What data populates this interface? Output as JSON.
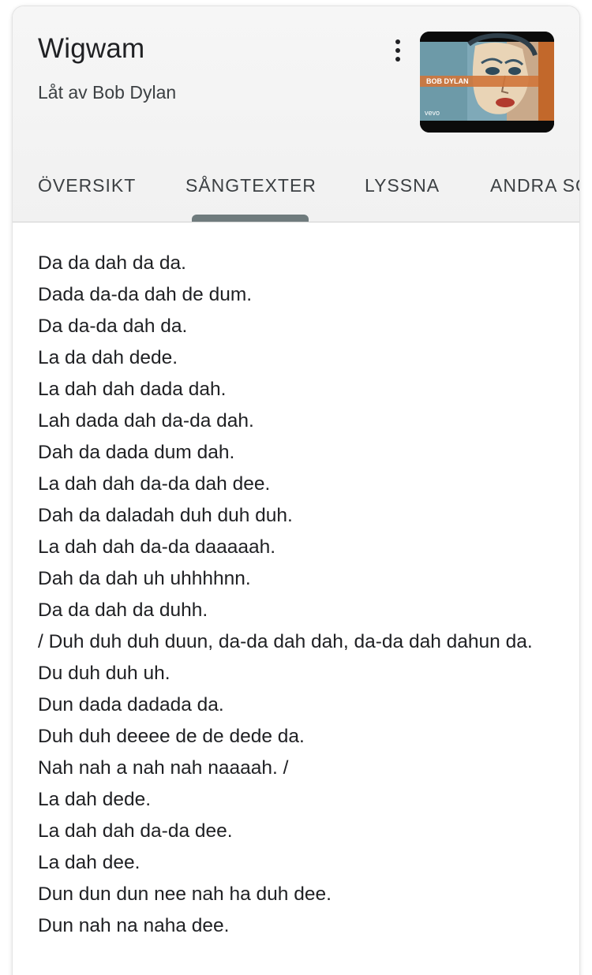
{
  "header": {
    "title": "Wigwam",
    "subtitle": "Låt av Bob Dylan",
    "more_icon": "more-vert-icon"
  },
  "thumbnail": {
    "artist_label": "BOB DYLAN",
    "brand_label": "vevo"
  },
  "tabs": [
    {
      "label": "ÖVERSIKT",
      "active": false
    },
    {
      "label": "SÅNGTEXTER",
      "active": true
    },
    {
      "label": "LYSSNA",
      "active": false
    },
    {
      "label": "ANDRA SÖKNINGAR",
      "active": false
    }
  ],
  "lyrics": [
    "Da da dah da da.",
    "Dada da-da dah de dum.",
    "Da da-da dah da.",
    "La da dah dede.",
    "La dah dah dada dah.",
    "Lah dada dah da-da dah.",
    "Dah da dada dum dah.",
    "La dah dah da-da dah dee.",
    "Dah da daladah duh duh duh.",
    "La dah dah da-da daaaaah.",
    "Dah da dah uh uhhhhnn.",
    "Da da dah da duhh.",
    "/ Duh duh duh duun, da-da dah dah, da-da dah dahun da.",
    "Du duh duh uh.",
    "Dun dada dadada da.",
    "Duh duh deeee de de dede da.",
    "Nah nah a nah nah naaaah. /",
    "La dah dede.",
    "La dah dah da-da dee.",
    "La dah dee.",
    "Dun dun dun nee nah ha duh dee.",
    "Dun nah na naha dee."
  ],
  "colors": {
    "title": "#202124",
    "tab_indicator": "#6f7b7d",
    "header_bg": "#f3f3f3"
  }
}
